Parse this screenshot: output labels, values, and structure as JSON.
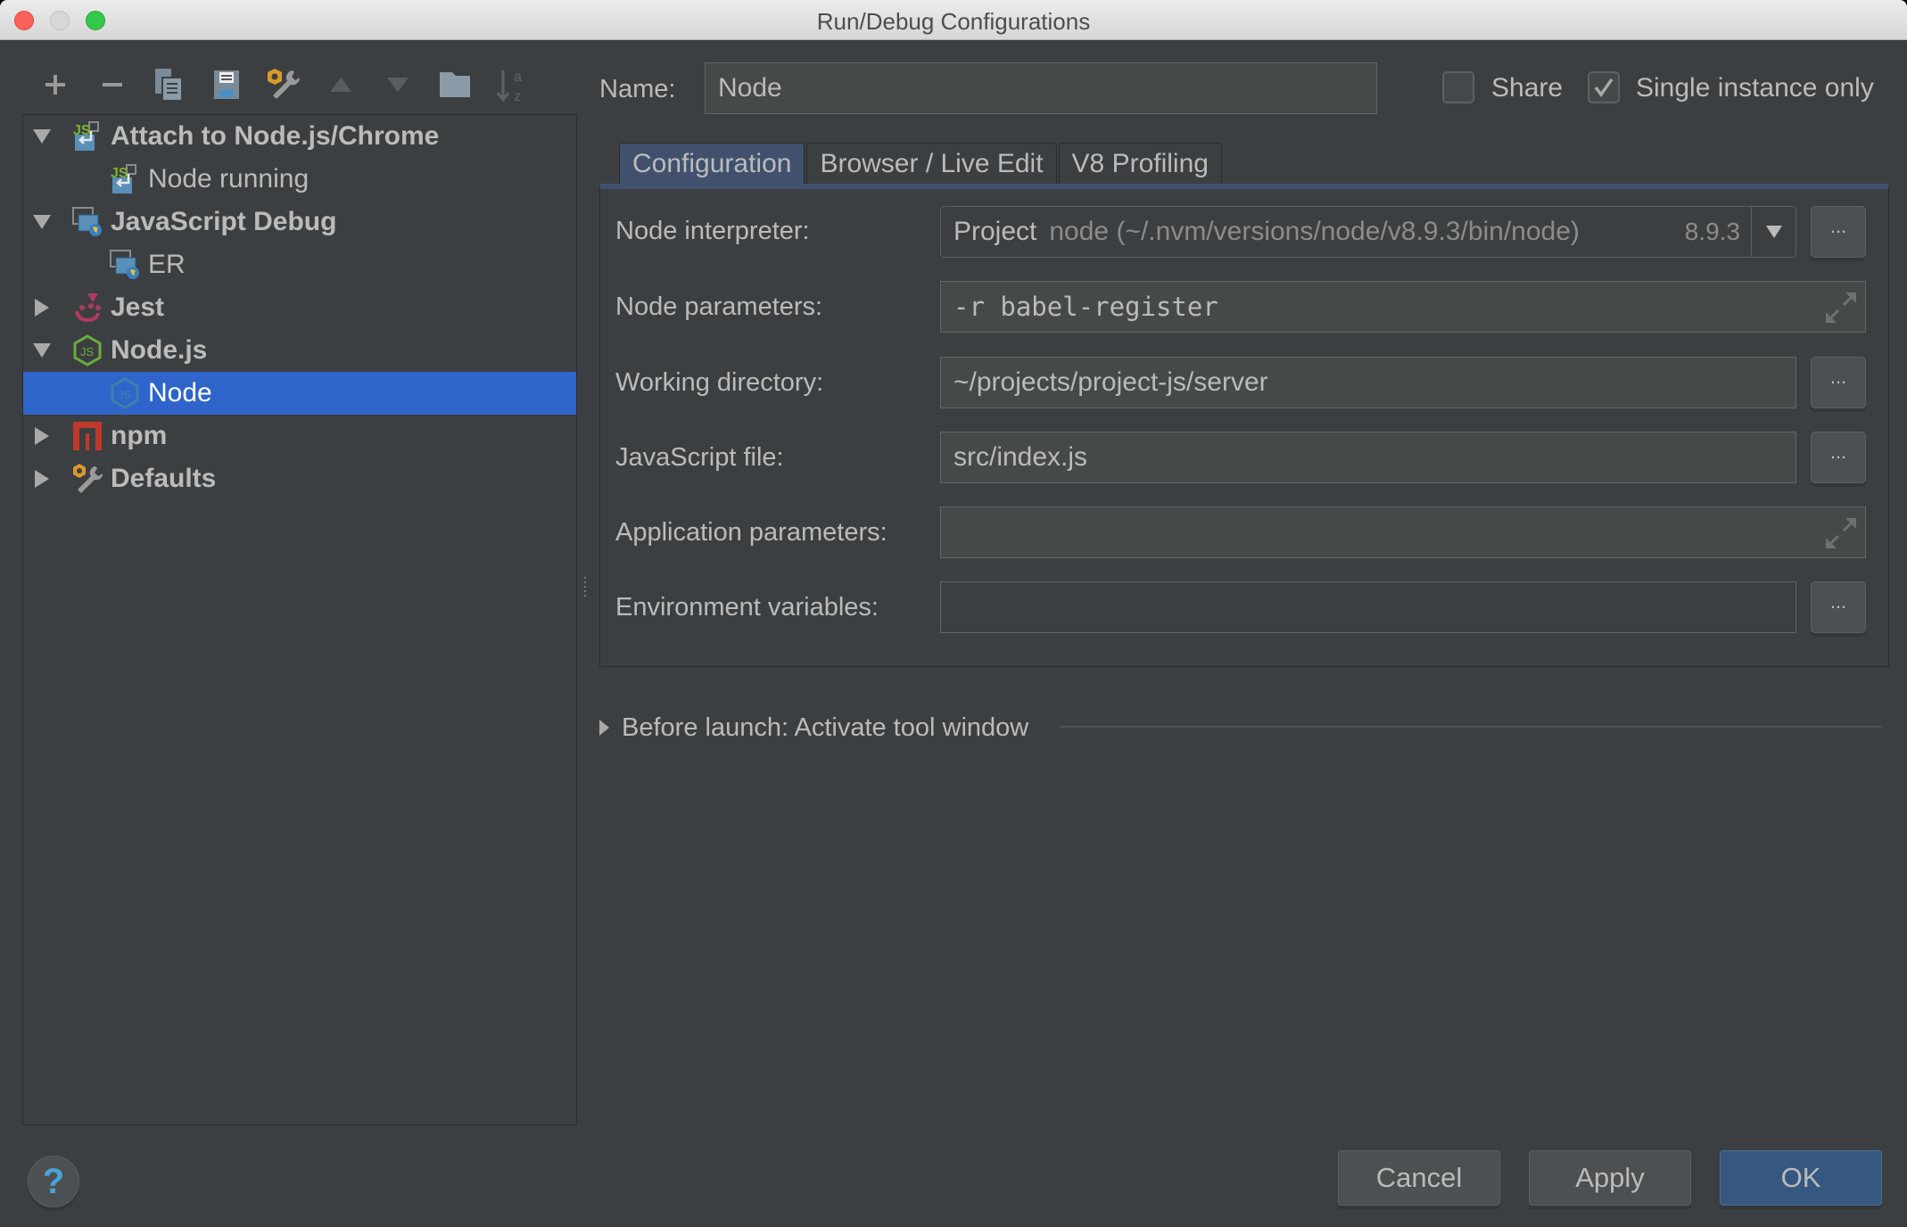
{
  "window": {
    "title": "Run/Debug Configurations"
  },
  "toolbar": {
    "buttons": [
      {
        "name": "add",
        "icon": "plus-icon"
      },
      {
        "name": "remove",
        "icon": "minus-icon"
      },
      {
        "name": "copy",
        "icon": "copy-icon"
      },
      {
        "name": "save",
        "icon": "save-icon"
      },
      {
        "name": "edit-defaults",
        "icon": "wrench-icon"
      },
      {
        "name": "move-up",
        "icon": "arrow-up-icon"
      },
      {
        "name": "move-down",
        "icon": "arrow-down-icon"
      },
      {
        "name": "folder",
        "icon": "folder-icon"
      },
      {
        "name": "sort",
        "icon": "sort-alpha-icon"
      }
    ]
  },
  "tree": {
    "items": [
      {
        "label": "Attach to Node.js/Chrome",
        "level": 0,
        "expanded": true,
        "icon": "js-attach-icon",
        "bold": true
      },
      {
        "label": "Node running",
        "level": 1,
        "icon": "js-attach-icon",
        "bold": false
      },
      {
        "label": "JavaScript Debug",
        "level": 0,
        "expanded": true,
        "icon": "js-debug-icon",
        "bold": true
      },
      {
        "label": "ER",
        "level": 1,
        "icon": "js-debug-icon",
        "bold": false
      },
      {
        "label": "Jest",
        "level": 0,
        "expanded": false,
        "icon": "jest-icon",
        "bold": true
      },
      {
        "label": "Node.js",
        "level": 0,
        "expanded": true,
        "icon": "nodejs-icon",
        "bold": true
      },
      {
        "label": "Node",
        "level": 1,
        "icon": "nodejs-icon",
        "bold": false,
        "selected": true
      },
      {
        "label": "npm",
        "level": 0,
        "expanded": false,
        "icon": "npm-icon",
        "bold": true
      },
      {
        "label": "Defaults",
        "level": 0,
        "expanded": false,
        "icon": "wrench-icon",
        "bold": true
      }
    ]
  },
  "name": {
    "label": "Name:",
    "value": "Node"
  },
  "options": {
    "share_label": "Share",
    "share_checked": false,
    "single_instance_label": "Single instance only",
    "single_instance_checked": true
  },
  "tabs": [
    {
      "label": "Configuration",
      "active": true
    },
    {
      "label": "Browser / Live Edit",
      "active": false
    },
    {
      "label": "V8 Profiling",
      "active": false
    }
  ],
  "config": {
    "node_interpreter": {
      "label": "Node interpreter:",
      "scope": "Project",
      "path": "node (~/.nvm/versions/node/v8.9.3/bin/node)",
      "version": "8.9.3"
    },
    "node_parameters": {
      "label": "Node parameters:",
      "value": "-r babel-register"
    },
    "working_directory": {
      "label": "Working directory:",
      "value": "~/projects/project-js/server"
    },
    "javascript_file": {
      "label": "JavaScript file:",
      "value": "src/index.js"
    },
    "application_parameters": {
      "label": "Application parameters:",
      "value": ""
    },
    "environment_variables": {
      "label": "Environment variables:",
      "value": ""
    },
    "browse_label": "..."
  },
  "before_launch": {
    "label": "Before launch: Activate tool window"
  },
  "footer": {
    "help_label": "?",
    "cancel_label": "Cancel",
    "apply_label": "Apply",
    "ok_label": "OK"
  },
  "colors": {
    "background": "#3c3f41",
    "selection": "#2f65ca",
    "active_tab": "#41516d",
    "primary_button": "#365880",
    "field_background": "#45494a"
  }
}
